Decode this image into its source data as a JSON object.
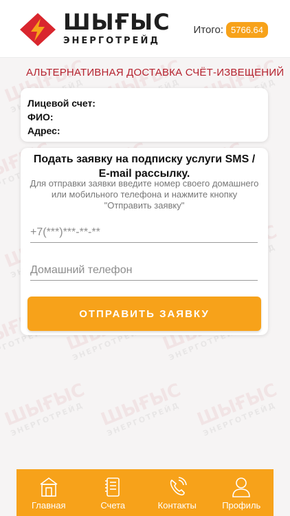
{
  "header": {
    "logo": {
      "line1": "ШЫҒЫС",
      "line2": "ЭНЕРГОТРЕЙД"
    },
    "total_label": "Итого:",
    "total_value": "5766.64"
  },
  "section_title": "АЛЬТЕРНАТИВНАЯ ДОСТАВКА СЧЁТ-ИЗВЕЩЕНИЙ",
  "account": {
    "account_label": "Лицевой счет:",
    "name_label": "ФИО:",
    "address_label": "Адрес:"
  },
  "form": {
    "title_line1": "Подать заявку на подписку услуги SMS /",
    "title_line2": "E-mail рассылку.",
    "hint": "Для отправки заявки введите номер своего домашнего или мобильного телефона и нажмите кнопку \"Отправить заявку\"",
    "mobile_placeholder": "+7(***)***-**-**",
    "home_placeholder": "Домашний телефон",
    "submit_label": "ОТПРАВИТЬ ЗАЯВКУ"
  },
  "nav": {
    "items": [
      {
        "label": "Главная",
        "icon": "home-icon"
      },
      {
        "label": "Счета",
        "icon": "notebook-icon"
      },
      {
        "label": "Контакты",
        "icon": "phone-icon"
      },
      {
        "label": "Профиль",
        "icon": "user-icon"
      }
    ]
  },
  "colors": {
    "accent": "#f7a21a",
    "brand_red": "#b5232f",
    "background": "#f6f4f4"
  }
}
